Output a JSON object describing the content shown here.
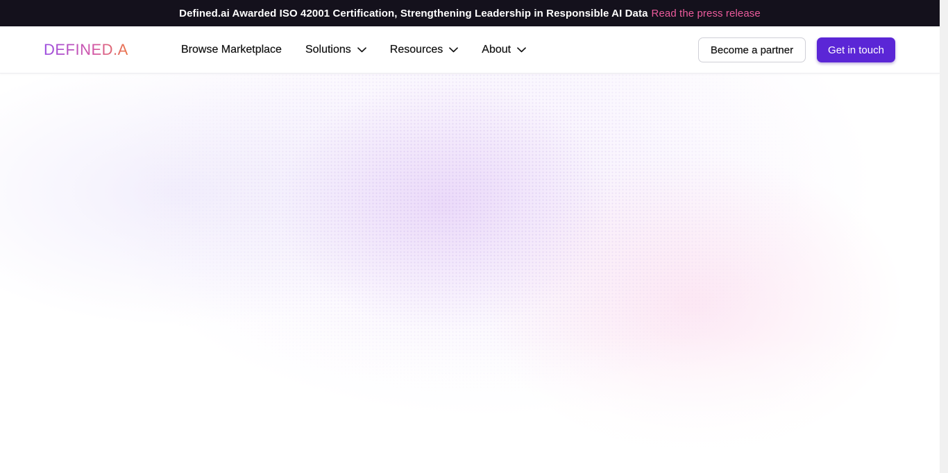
{
  "announcement": {
    "text": "Defined.ai Awarded ISO 42001 Certification, Strengthening Leadership in Responsible AI Data",
    "link_label": "Read the press release"
  },
  "brand": {
    "logo_text": "DEFINED.AI",
    "gradient_start": "#9b4ee0",
    "gradient_end": "#ee7a3c"
  },
  "nav": {
    "items": [
      {
        "label": "Browse Marketplace",
        "has_dropdown": false
      },
      {
        "label": "Solutions",
        "has_dropdown": true,
        "icon": "chevron-down-icon"
      },
      {
        "label": "Resources",
        "has_dropdown": true,
        "icon": "chevron-down-icon"
      },
      {
        "label": "About",
        "has_dropdown": true,
        "icon": "chevron-down-icon"
      }
    ]
  },
  "actions": {
    "partner_label": "Become a partner",
    "contact_label": "Get in touch"
  },
  "colors": {
    "announcement_bg": "#14111c",
    "link_pink": "#ec5b9c",
    "primary_button": "#5b26d6"
  }
}
